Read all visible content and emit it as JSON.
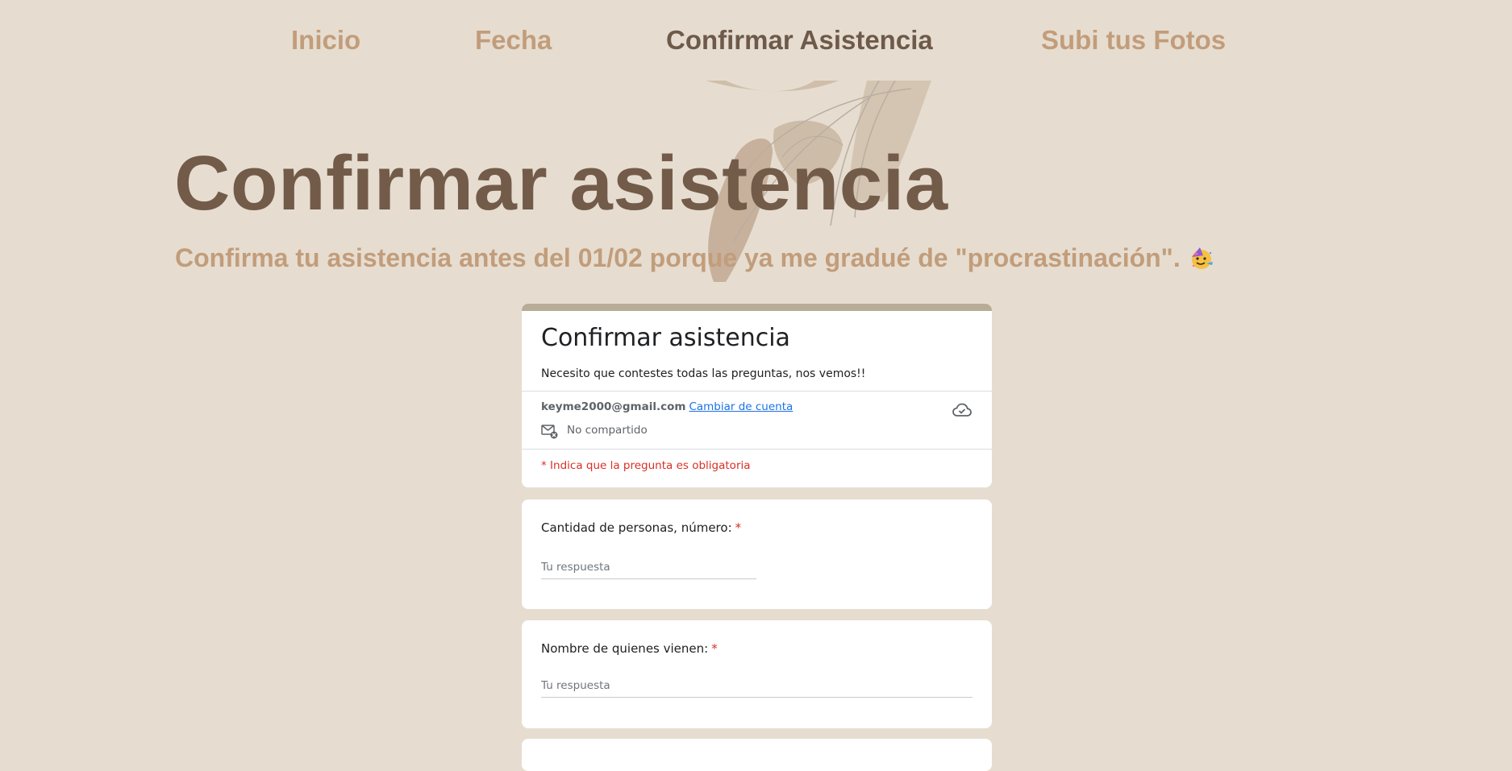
{
  "nav": {
    "items": [
      {
        "label": "Inicio"
      },
      {
        "label": "Fecha"
      },
      {
        "label": "Confirmar Asistencia",
        "active": true
      },
      {
        "label": "Subi tus Fotos"
      }
    ]
  },
  "hero": {
    "title": "Confirmar asistencia",
    "subtitle": "Confirma tu asistencia antes del 01/02 porque ya me gradué de \"procrastinación\"."
  },
  "form": {
    "title": "Confirmar asistencia",
    "description": "Necesito que contestes todas las preguntas, nos vemos!!",
    "account_email": "keyme2000@gmail.com",
    "switch_account": "Cambiar de cuenta",
    "not_shared": "No compartido",
    "required_note": "* Indica que la pregunta es obligatoria",
    "questions": [
      {
        "label": "Cantidad de personas, número:",
        "required_mark": "*",
        "placeholder": "Tu respuesta"
      },
      {
        "label": "Nombre de quienes vienen:",
        "required_mark": "*",
        "placeholder": "Tu respuesta"
      }
    ]
  },
  "colors": {
    "background": "#e6ddd0",
    "nav_text": "#c29d7b",
    "nav_active": "#6e5a4a",
    "title": "#735b49",
    "form_accent": "#b7ad97",
    "required": "#d93025",
    "link": "#1a73e8"
  },
  "icons": {
    "cloud": "cloud-check-icon",
    "mail": "mail-not-shared-icon",
    "emoji": "partying-face-emoji"
  }
}
